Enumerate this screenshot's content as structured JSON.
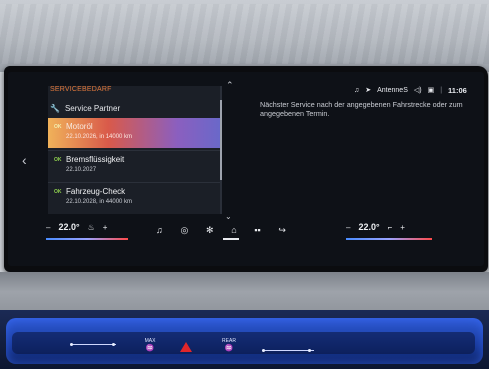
{
  "status_bar": {
    "radio_station": "AntenneS",
    "time": "11:06"
  },
  "service": {
    "section_title": "SERVICEBEDARF",
    "partner_label": "Service Partner",
    "items": [
      {
        "badge": "OK",
        "title": "Motoröl",
        "subtitle": "22.10.2026, in 14000 km",
        "selected": true
      },
      {
        "badge": "OK",
        "title": "Bremsflüssigkeit",
        "subtitle": "22.10.2027",
        "selected": false
      },
      {
        "badge": "OK",
        "title": "Fahrzeug-Check",
        "subtitle": "22.10.2028, in 44000 km",
        "selected": false
      }
    ],
    "description": "Nächster Service nach der angegebenen Fahrstrecke oder zum angegebenen Termin."
  },
  "climate": {
    "left": {
      "minus": "–",
      "temp": "22.0°",
      "plus": "+"
    },
    "right": {
      "minus": "–",
      "temp": "22.0°",
      "plus": "+"
    }
  },
  "nav_bar": {
    "icons": [
      "music-icon",
      "navigation-icon",
      "fan-icon",
      "home-icon",
      "apps-icon",
      "phone-icon"
    ]
  },
  "console": {
    "max_label": "MAX",
    "rear_label": "REAR"
  },
  "colors": {
    "accent_orange": "#e0783c",
    "ok_green": "#8fd14f",
    "hazard_red": "#e0262a"
  }
}
